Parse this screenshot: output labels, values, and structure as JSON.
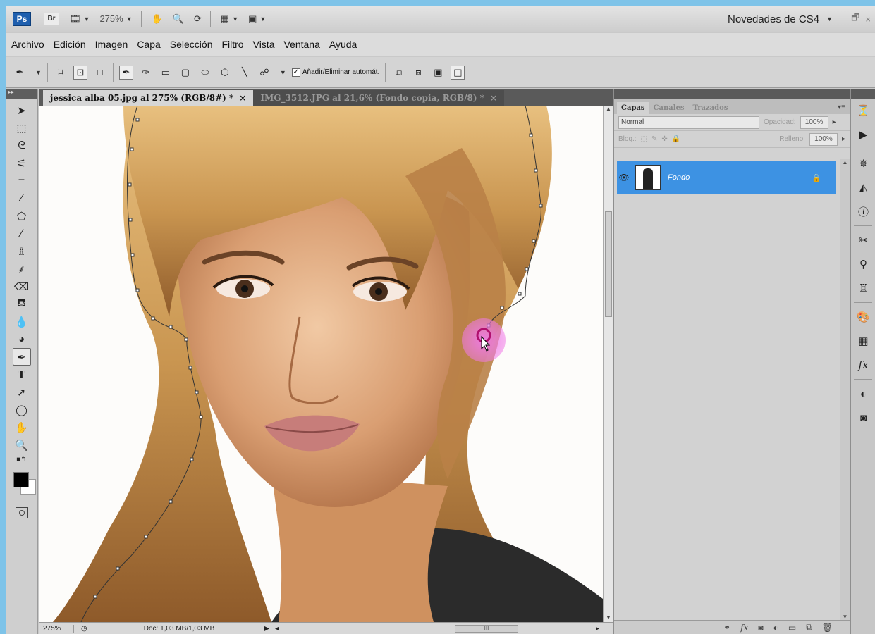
{
  "appbar": {
    "logo": "Ps",
    "bridge": "Br",
    "zoom": "275%",
    "workspace": "Novedades de CS4",
    "win_controls": [
      "–",
      "🗗",
      "×"
    ]
  },
  "menu": [
    "Archivo",
    "Edición",
    "Imagen",
    "Capa",
    "Selección",
    "Filtro",
    "Vista",
    "Ventana",
    "Ayuda"
  ],
  "options": {
    "auto_add_delete_label": "Añadir/Eliminar automát.",
    "auto_add_delete_checked": true
  },
  "document": {
    "tabs": [
      {
        "label": "jessica alba 05.jpg al 275% (RGB/8#) *",
        "close": "×",
        "active": true
      },
      {
        "label": "IMG_3512.JPG al 21,6% (Fondo copia, RGB/8) *",
        "close": "×",
        "active": false
      }
    ],
    "status_zoom": "275%",
    "status_doc": "Doc: 1,03 MB/1,03 MB",
    "hscroll_label": "III"
  },
  "layers_panel": {
    "tabs": [
      "Capas",
      "Canales",
      "Trazados"
    ],
    "blend_mode": "Normal",
    "opacity_label": "Opacidad:",
    "opacity_value": "100%",
    "lock_label": "Bloq.:",
    "fill_label": "Relleno:",
    "fill_value": "100%",
    "layers": [
      {
        "name": "Fondo",
        "visible": true,
        "locked": true,
        "selected": true
      }
    ]
  },
  "colors": {
    "accent": "#3d92e3",
    "foreground": "#000000",
    "background": "#ffffff",
    "pen_cursor": "#e05ad6"
  }
}
